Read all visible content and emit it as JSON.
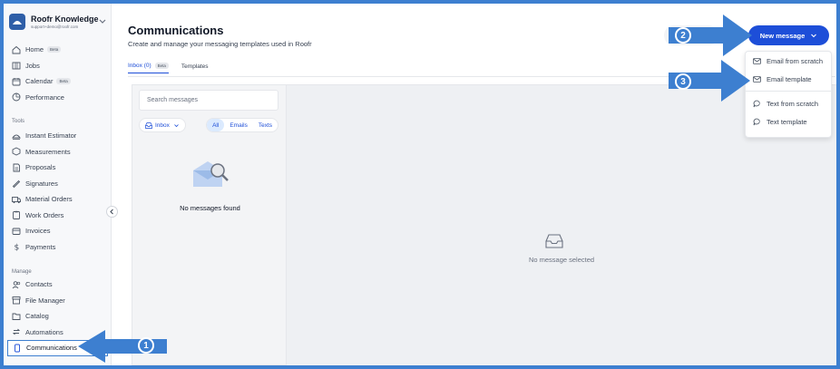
{
  "org": {
    "name": "Roofr Knowledge",
    "email": "support+demo@roofr.com"
  },
  "nav_main": [
    {
      "label": "Home",
      "badge": "Beta",
      "icon": "home-icon"
    },
    {
      "label": "Jobs",
      "badge": "",
      "icon": "jobs-icon"
    },
    {
      "label": "Calendar",
      "badge": "Beta",
      "icon": "calendar-icon"
    },
    {
      "label": "Performance",
      "badge": "",
      "icon": "performance-icon"
    }
  ],
  "tools_label": "Tools",
  "nav_tools": [
    {
      "label": "Instant Estimator",
      "icon": "estimator-icon"
    },
    {
      "label": "Measurements",
      "icon": "measurements-icon"
    },
    {
      "label": "Proposals",
      "icon": "proposals-icon"
    },
    {
      "label": "Signatures",
      "icon": "signatures-icon"
    },
    {
      "label": "Material Orders",
      "icon": "truck-icon"
    },
    {
      "label": "Work Orders",
      "icon": "clipboard-icon"
    },
    {
      "label": "Invoices",
      "icon": "invoice-icon"
    },
    {
      "label": "Payments",
      "icon": "dollar-icon"
    }
  ],
  "manage_label": "Manage",
  "nav_manage": [
    {
      "label": "Contacts",
      "icon": "contacts-icon"
    },
    {
      "label": "File Manager",
      "icon": "file-manager-icon"
    },
    {
      "label": "Catalog",
      "icon": "folder-icon"
    },
    {
      "label": "Automations",
      "icon": "automations-icon"
    },
    {
      "label": "Communications",
      "icon": "phone-icon"
    }
  ],
  "page": {
    "title": "Communications",
    "subtitle": "Create and manage your messaging templates used in Roofr"
  },
  "tabs": {
    "inbox": "Inbox (0)",
    "inbox_badge": "Beta",
    "templates": "Templates"
  },
  "search": {
    "placeholder": "Search messages"
  },
  "filters": {
    "inbox": "Inbox",
    "all": "All",
    "emails": "Emails",
    "texts": "Texts"
  },
  "empty": {
    "messages": "No messages found",
    "selected": "No message selected"
  },
  "new_message": {
    "label": "New message",
    "menu": [
      "Email from scratch",
      "Email template",
      "Text from scratch",
      "Text template"
    ]
  },
  "annotations": [
    "1",
    "2",
    "3"
  ],
  "colors": {
    "accent": "#1d4ed8",
    "frame": "#3d7fd0"
  }
}
